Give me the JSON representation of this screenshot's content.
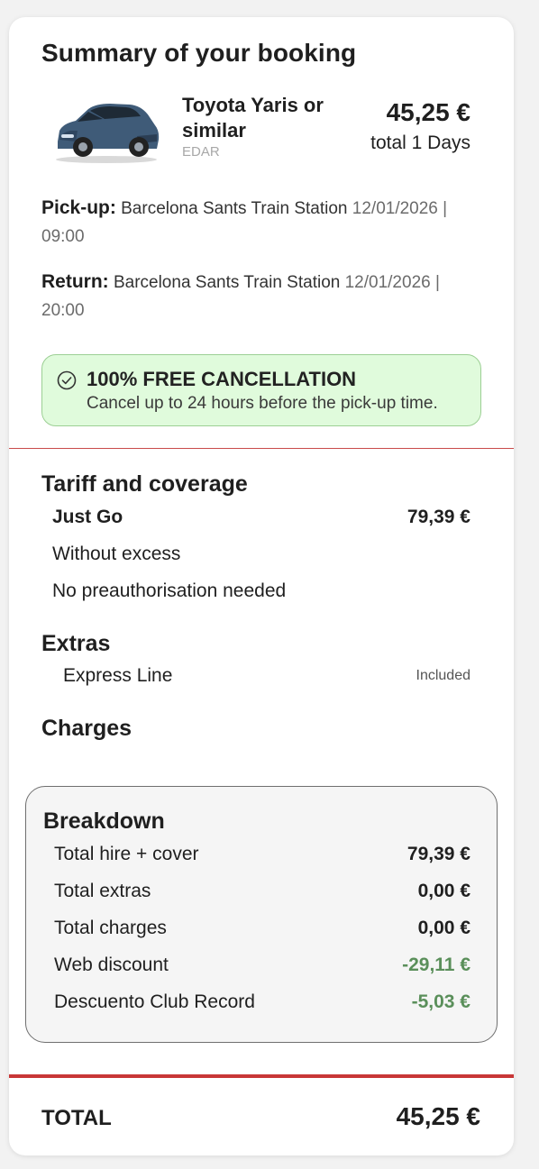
{
  "summary": {
    "title": "Summary of your booking",
    "car": {
      "name": "Toyota Yaris or similar",
      "code": "EDAR",
      "price": "45,25 €",
      "duration": "total 1 Days"
    },
    "pickup": {
      "label": "Pick-up:",
      "location": "Barcelona Sants Train Station",
      "datetime": "12/01/2026 | 09:00"
    },
    "return": {
      "label": "Return:",
      "location": "Barcelona Sants Train Station",
      "datetime": "12/01/2026 | 20:00"
    },
    "cancellation": {
      "icon": "check-circle-icon",
      "title": "100% FREE CANCELLATION",
      "text": "Cancel up to 24 hours before the pick-up time."
    }
  },
  "tariff": {
    "heading": "Tariff and coverage",
    "plan_name": "Just Go",
    "plan_price": "79,39 €",
    "features": [
      "Without excess",
      "No preauthorisation needed"
    ]
  },
  "extras": {
    "heading": "Extras",
    "items": [
      {
        "name": "Express Line",
        "status": "Included"
      }
    ]
  },
  "charges": {
    "heading": "Charges"
  },
  "breakdown": {
    "heading": "Breakdown",
    "rows": [
      {
        "label": "Total hire + cover",
        "value": "79,39 €"
      },
      {
        "label": "Total extras",
        "value": "0,00 €"
      },
      {
        "label": "Total charges",
        "value": "0,00 €"
      },
      {
        "label": "Web discount",
        "value": "-29,11 €"
      },
      {
        "label": "Descuento Club Record",
        "value": "-5,03 €"
      }
    ]
  },
  "total": {
    "label": "TOTAL",
    "value": "45,25 €"
  },
  "colors": {
    "accent_red": "#c83737",
    "discount_green": "#5a8f5a",
    "cancel_bg": "#e0fbdc",
    "car_body": "#3f5b78"
  }
}
